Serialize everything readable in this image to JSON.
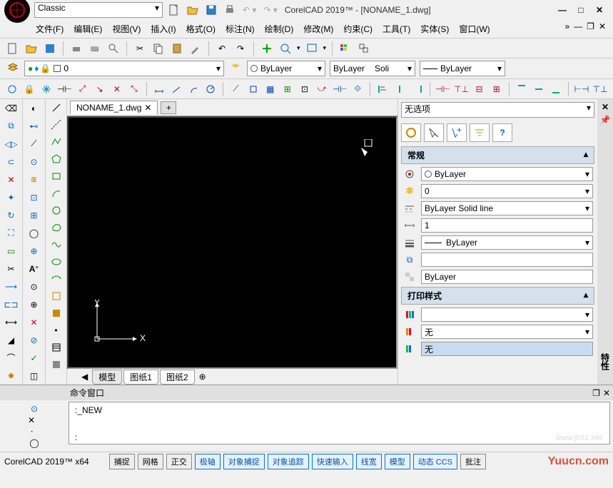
{
  "workspace": "Classic",
  "title": "CorelCAD 2019™ - [NONAME_1.dwg]",
  "menus": [
    "文件(F)",
    "编辑(E)",
    "视图(V)",
    "插入(I)",
    "格式(O)",
    "标注(N)",
    "绘制(D)",
    "修改(M)",
    "约束(C)",
    "工具(T)",
    "实体(S)",
    "窗口(W)"
  ],
  "tab": {
    "name": "NONAME_1.dwg"
  },
  "layer": {
    "current": "0"
  },
  "color": {
    "bylayer": "ByLayer"
  },
  "linetype": {
    "label": "ByLayer",
    "style": "Soli"
  },
  "lineweight": {
    "label": "ByLayer"
  },
  "sheets": [
    "模型",
    "图纸1",
    "图纸2"
  ],
  "props": {
    "selection": "无选项",
    "section_general": "常规",
    "section_print": "打印样式",
    "color": "ByLayer",
    "layer": "0",
    "linetype": "ByLayer    Solid line",
    "scale": "1",
    "lineweight": "ByLayer",
    "hyperlink": "",
    "transparency": "ByLayer",
    "printstyle": "",
    "printstyle2": "无",
    "printstyle3": "无"
  },
  "cmd": {
    "title": "命令窗口",
    "history": ":_NEW",
    "prompt": ":"
  },
  "status": {
    "app": "CorelCAD 2019™ x64",
    "buttons_gray": [
      "捕捉",
      "网格",
      "正交"
    ],
    "buttons_blue": [
      "极轴",
      "对象捕捉",
      "对象追踪",
      "快速输入",
      "线宽",
      "模型",
      "动态 CCS"
    ],
    "buttons_end": [
      "批注"
    ],
    "watermark": "Yuucn.com"
  },
  "right_label": "特性"
}
